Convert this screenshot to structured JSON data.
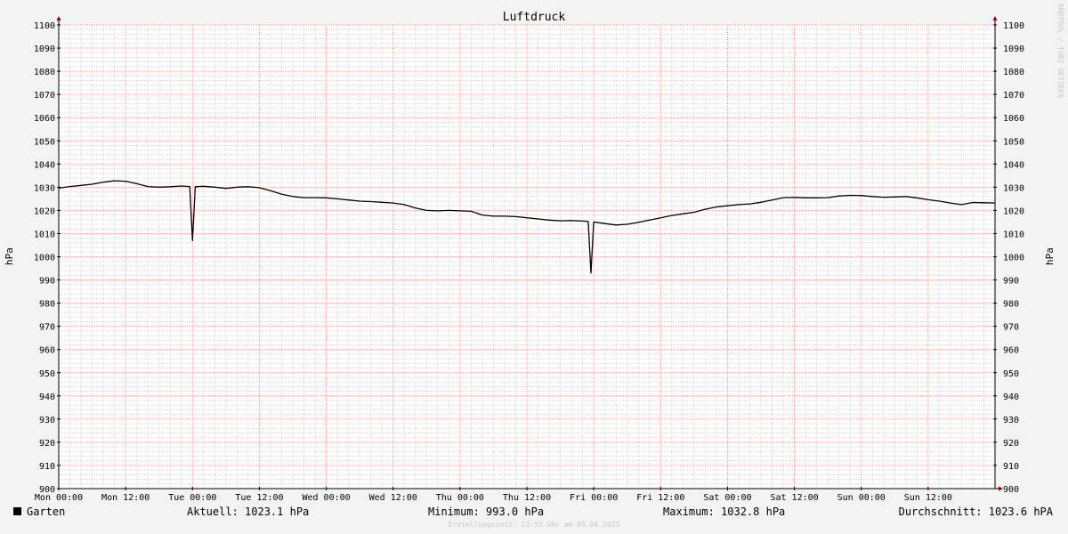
{
  "chart_data": {
    "type": "line",
    "title": "Luftdruck",
    "ylabel_left": "hPa",
    "ylabel_right": "hPa",
    "ylim": [
      900,
      1100
    ],
    "xlim": [
      0,
      168
    ],
    "y_ticks": [
      900,
      910,
      920,
      930,
      940,
      950,
      960,
      970,
      980,
      990,
      1000,
      1010,
      1020,
      1030,
      1040,
      1050,
      1060,
      1070,
      1080,
      1090,
      1100
    ],
    "y_tick_labels": [
      "900",
      "910",
      "920",
      "930",
      "940",
      "950",
      "960",
      "970",
      "980",
      "990",
      "1000",
      "1010",
      "1020",
      "1030",
      "1040",
      "1050",
      "1060",
      "1070",
      "1080",
      "1090",
      "1100"
    ],
    "x_ticks": [
      0,
      12,
      24,
      36,
      48,
      60,
      72,
      84,
      96,
      108,
      120,
      132,
      144,
      156
    ],
    "x_tick_labels": [
      "Mon 00:00",
      "Mon 12:00",
      "Tue 00:00",
      "Tue 12:00",
      "Wed 00:00",
      "Wed 12:00",
      "Thu 00:00",
      "Thu 12:00",
      "Fri 00:00",
      "Fri 12:00",
      "Sat 00:00",
      "Sat 12:00",
      "Sun 00:00",
      "Sun 12:00"
    ],
    "grid": true,
    "colors": {
      "background": "#f3f3f3",
      "plot_background": "#ffffff",
      "major_grid": "#f0a0a0",
      "minor_grid": "#d8d8d8",
      "axis": "#000000",
      "arrow": "#990000",
      "line": "#000000"
    },
    "series": [
      {
        "name": "Garten",
        "color": "#000000",
        "x": [
          0,
          2,
          4,
          6,
          8,
          10,
          12,
          14,
          16,
          18,
          20,
          22,
          23.5,
          24,
          24.5,
          26,
          28,
          30,
          32,
          34,
          36,
          38,
          40,
          42,
          44,
          46,
          48,
          50,
          52,
          54,
          56,
          58,
          60,
          62,
          64,
          66,
          68,
          70,
          72,
          74,
          76,
          78,
          80,
          82,
          84,
          86,
          88,
          90,
          92,
          94,
          95,
          95.5,
          96,
          98,
          100,
          102,
          104,
          106,
          108,
          110,
          112,
          114,
          116,
          118,
          120,
          122,
          124,
          126,
          128,
          130,
          132,
          134,
          136,
          138,
          140,
          142,
          144,
          146,
          148,
          150,
          152,
          154,
          156,
          158,
          160,
          162,
          164,
          166,
          168
        ],
        "values": [
          1029.6,
          1030.3,
          1030.8,
          1031.3,
          1032.2,
          1032.8,
          1032.6,
          1031.5,
          1030.3,
          1030.0,
          1030.2,
          1030.5,
          1030.3,
          1007.0,
          1030.2,
          1030.4,
          1030.0,
          1029.5,
          1030.0,
          1030.2,
          1029.8,
          1028.5,
          1027.0,
          1026.0,
          1025.5,
          1025.5,
          1025.4,
          1025.0,
          1024.5,
          1024.0,
          1023.8,
          1023.5,
          1023.2,
          1022.5,
          1021.0,
          1020.0,
          1019.8,
          1020.0,
          1019.8,
          1019.6,
          1018.0,
          1017.5,
          1017.5,
          1017.3,
          1016.8,
          1016.3,
          1015.8,
          1015.5,
          1015.6,
          1015.4,
          1015.2,
          993.0,
          1015.0,
          1014.3,
          1013.7,
          1014.0,
          1014.8,
          1015.8,
          1016.8,
          1017.8,
          1018.5,
          1019.2,
          1020.5,
          1021.5,
          1022.0,
          1022.5,
          1022.8,
          1023.5,
          1024.5,
          1025.5,
          1025.6,
          1025.4,
          1025.4,
          1025.5,
          1026.2,
          1026.5,
          1026.4,
          1026.0,
          1025.7,
          1025.8,
          1026.0,
          1025.4,
          1024.6,
          1024.0,
          1023.2,
          1022.5,
          1023.4,
          1023.3,
          1023.2
        ]
      }
    ],
    "legend": {
      "position": "bottom-left",
      "name": "Garten",
      "swatch_color": "#000000"
    },
    "stats": {
      "current": "Aktuell: 1023.1 hPa",
      "minimum": "Minimum: 993.0 hPa",
      "maximum": "Maximum: 1032.8 hPa",
      "average": "Durchschnitt: 1023.6 hPA"
    },
    "footer": "Erstellungszeit: 23:55 Uhr am 09.04.2023",
    "watermark": "RRDTOOL / TOBI OETIKER"
  }
}
